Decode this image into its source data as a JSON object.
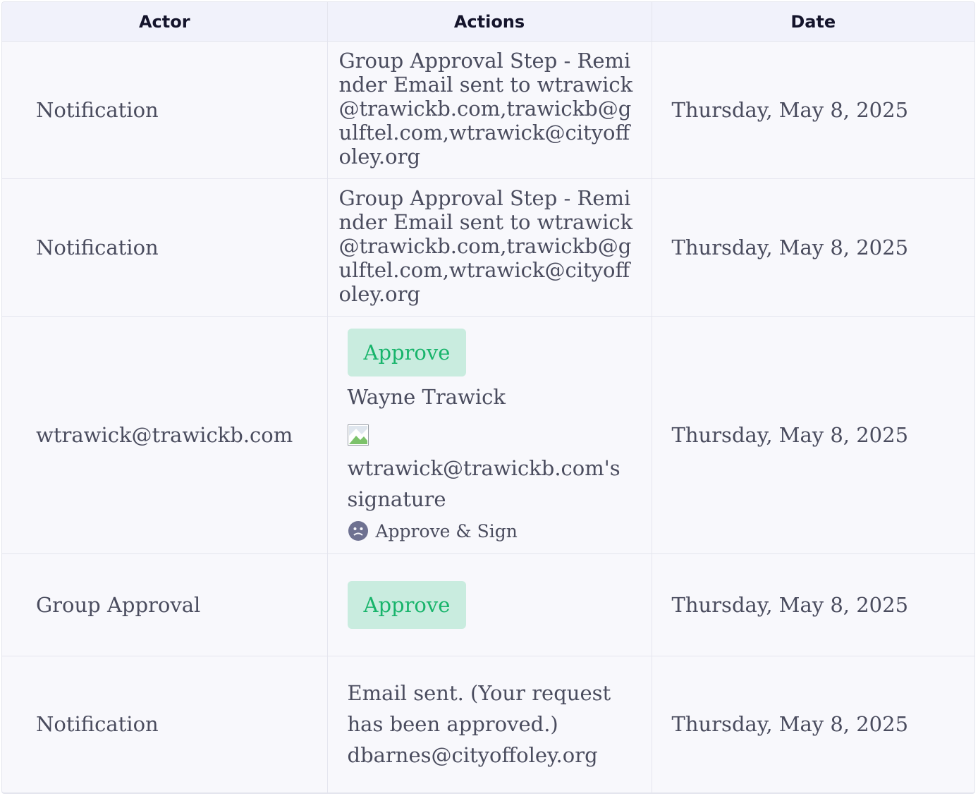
{
  "table": {
    "headers": [
      "Actor",
      "Actions",
      "Date"
    ],
    "rows": [
      {
        "actor": "Notification",
        "action_text": "Group Approval Step - Reminder Email sent to wtrawick@trawickb.com,trawickb@gulftel.com,wtrawick@cityoffoley.org",
        "date": "Thursday, May 8, 2025"
      },
      {
        "actor": "Notification",
        "action_text": "Group Approval Step - Reminder Email sent to wtrawick@trawickb.com,trawickb@gulftel.com,wtrawick@cityoffoley.org",
        "date": "Thursday, May 8, 2025"
      },
      {
        "actor": "wtrawick@trawickb.com",
        "approve_label": "Approve",
        "signer_name": "Wayne Trawick",
        "signature_alt": "wtrawick@trawickb.com's signature",
        "sign_tag": "Approve & Sign",
        "date": "Thursday, May 8, 2025"
      },
      {
        "actor": "Group Approval",
        "approve_label": "Approve",
        "date": "Thursday, May 8, 2025"
      },
      {
        "actor": "Notification",
        "action_text": "Email sent. (Your request has been approved.) dbarnes@cityoffoley.org",
        "date": "Thursday, May 8, 2025"
      }
    ]
  },
  "colors": {
    "approve_bg": "#c9ecdf",
    "approve_text": "#18b46b",
    "header_bg": "#f1f2fb",
    "row_bg": "#f8f8fc"
  },
  "icons": {
    "broken_image": "broken-image-icon",
    "sign_tag": "face-icon"
  }
}
